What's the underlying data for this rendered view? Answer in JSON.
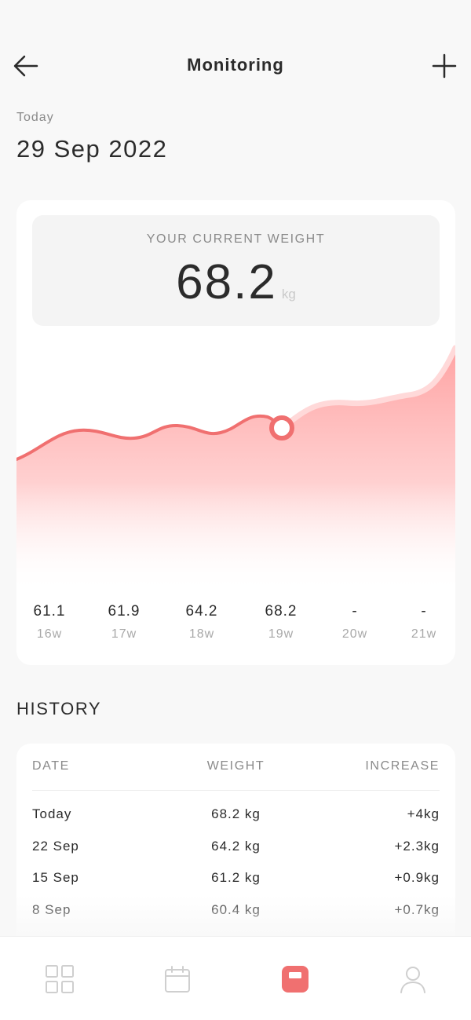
{
  "header": {
    "title": "Monitoring"
  },
  "date": {
    "label": "Today",
    "value": "29 Sep 2022"
  },
  "current_weight": {
    "label": "YOUR CURRENT WEIGHT",
    "value": "68.2",
    "unit": "kg"
  },
  "weeks": [
    {
      "value": "61.1",
      "label": "16w"
    },
    {
      "value": "61.9",
      "label": "17w"
    },
    {
      "value": "64.2",
      "label": "18w"
    },
    {
      "value": "68.2",
      "label": "19w"
    },
    {
      "value": "-",
      "label": "20w"
    },
    {
      "value": "-",
      "label": "21w"
    }
  ],
  "history": {
    "title": "HISTORY",
    "columns": {
      "date": "DATE",
      "weight": "WEIGHT",
      "increase": "INCREASE"
    },
    "rows": [
      {
        "date": "Today",
        "weight": "68.2 kg",
        "increase": "+4kg"
      },
      {
        "date": "22 Sep",
        "weight": "64.2 kg",
        "increase": "+2.3kg"
      },
      {
        "date": "15 Sep",
        "weight": "61.2 kg",
        "increase": "+0.9kg"
      },
      {
        "date": "8 Sep",
        "weight": "60.4 kg",
        "increase": "+0.7kg"
      }
    ]
  },
  "nav": {
    "items": [
      {
        "icon": "grid-icon",
        "active": false
      },
      {
        "icon": "calendar-icon",
        "active": false
      },
      {
        "icon": "scale-icon",
        "active": true
      },
      {
        "icon": "user-icon",
        "active": false
      }
    ]
  },
  "colors": {
    "accent": "#f07070",
    "area_top": "#ffa3a3",
    "text_primary": "#2b2b2b",
    "text_muted": "#8a8a8a"
  }
}
